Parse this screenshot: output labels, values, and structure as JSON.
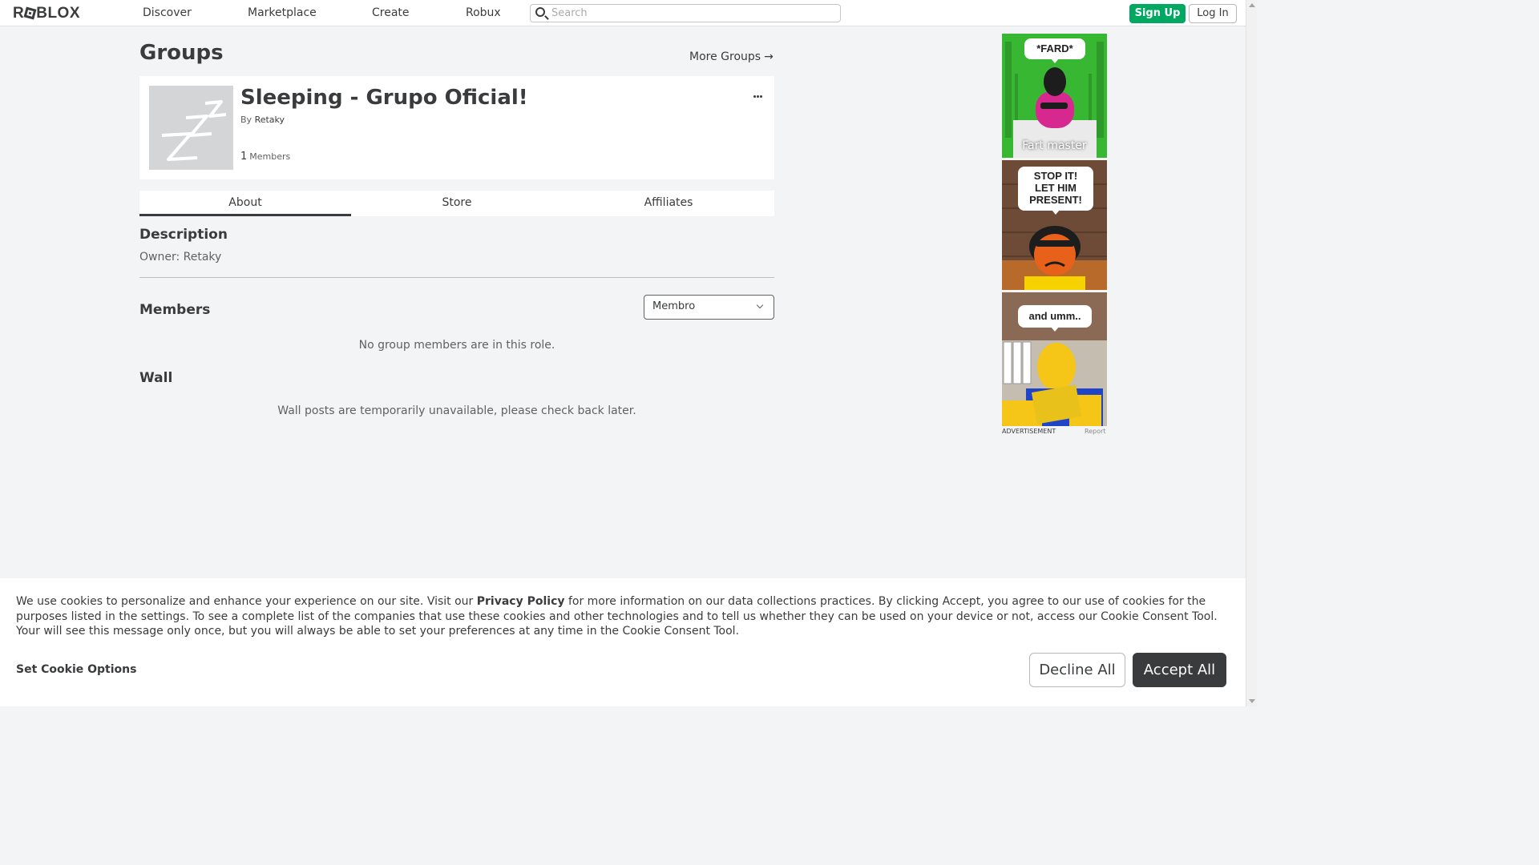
{
  "nav": {
    "logo": "ROBLOX",
    "links": [
      "Discover",
      "Marketplace",
      "Create",
      "Robux"
    ],
    "search_placeholder": "Search",
    "signup_label": "Sign Up",
    "login_label": "Log In"
  },
  "page": {
    "title": "Groups",
    "more_groups_label": "More Groups",
    "more_groups_arrow": "→"
  },
  "group": {
    "name": "Sleeping - Grupo Oficial!",
    "by_label": "By",
    "owner": "Retaky",
    "member_count": "1",
    "members_label": "Members"
  },
  "tabs": [
    {
      "label": "About",
      "active": true
    },
    {
      "label": "Store",
      "active": false
    },
    {
      "label": "Affiliates",
      "active": false
    }
  ],
  "about": {
    "description_heading": "Description",
    "description_text": "Owner: Retaky",
    "members_heading": "Members",
    "role_selected": "Membro",
    "no_members_text": "No group members are in this role.",
    "wall_heading": "Wall",
    "wall_text": "Wall posts are temporarily unavailable, please check back later."
  },
  "ad": {
    "panel1_bubble": "*FARD*",
    "panel1_caption": "Fart master",
    "panel2_bubble_line1": "STOP IT!",
    "panel2_bubble_line2": "LET HIM",
    "panel2_bubble_line3": "PRESENT!",
    "panel3_bubble": "and umm..",
    "label": "ADVERTISEMENT",
    "report": "Report",
    "colors": {
      "panel1_bg": "#38b832",
      "panel2_bg": "#6d4b36",
      "panel3_bg": "#c4bdb0",
      "char_yellow": "#f5c518",
      "char_orange": "#e8611a"
    }
  },
  "cookie": {
    "text_before": "We use cookies to personalize and enhance your experience on our site. Visit our ",
    "privacy_link": "Privacy Policy",
    "text_after": " for more information on our data collections practices. By clicking Accept, you agree to our use of cookies for the purposes listed in the settings. To see a complete list of the companies that use these cookies and other technologies and to tell us whether they can be used on your device or not, access our Cookie Consent Tool. Your will see this message only once, but you will always be able to set your preferences at any time in the Cookie Consent Tool.",
    "options_label": "Set Cookie Options",
    "decline_label": "Decline All",
    "accept_label": "Accept All"
  },
  "colors": {
    "brand_green": "#00a862",
    "text_dark": "#393b3d",
    "text_muted": "#606162",
    "page_bg": "#f2f4f5"
  },
  "icons": [
    "search-icon",
    "arrow-right-icon",
    "more-options-icon",
    "chevron-down-icon",
    "group-emblem-zzz-icon"
  ]
}
